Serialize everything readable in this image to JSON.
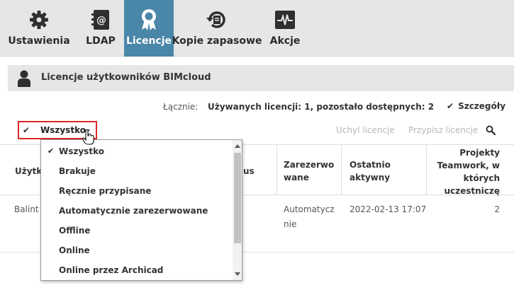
{
  "nav": {
    "tabs": [
      {
        "label": "Ustawienia",
        "icon": "gear-icon"
      },
      {
        "label": "LDAP",
        "icon": "address-book-icon"
      },
      {
        "label": "Licencje",
        "icon": "award-ribbon-icon"
      },
      {
        "label": "Kopie zapasowe",
        "icon": "backup-history-icon"
      },
      {
        "label": "Akcje",
        "icon": "activity-monitor-icon"
      }
    ],
    "active": "Licencje"
  },
  "header": {
    "title": "Licencje użytkowników BIMcloud"
  },
  "summary": {
    "label": "Łącznie:",
    "value": "Używanych licencji: 1, pozostało dostępnych: 2",
    "details": "Szczegóły"
  },
  "filter": {
    "selected": "Wszystko"
  },
  "actions": {
    "revoke": "Uchyl licencje",
    "assign": "Przypisz licencje"
  },
  "table": {
    "headers": [
      "Użytk",
      "us",
      "Zarezerwowane",
      "Ostatnio aktywny",
      "Projekty Teamwork, w których uczestniczę"
    ],
    "header_lines": {
      "reserved": [
        "Zarezerwo",
        "wane"
      ],
      "last_active": [
        "Ostatnio",
        "aktywny"
      ],
      "projects": [
        "Projekty",
        "Teamwork, w",
        "których",
        "uczestniczę"
      ]
    },
    "rows": [
      {
        "user": "Balint",
        "reserved": [
          "Automatycz",
          "nie"
        ],
        "last_active": "2022-02-13 17:07",
        "projects": "2"
      }
    ]
  },
  "dropdown": {
    "options": [
      {
        "label": "Wszystko",
        "checked": true
      },
      {
        "label": "Brakuje",
        "checked": false
      },
      {
        "label": "Ręcznie przypisane",
        "checked": false
      },
      {
        "label": "Automatycznie zarezerwowane",
        "checked": false
      },
      {
        "label": "Offline",
        "checked": false
      },
      {
        "label": "Online",
        "checked": false
      },
      {
        "label": "Online przez Archicad",
        "checked": false
      }
    ]
  },
  "colors": {
    "accent": "#4a86a8",
    "highlight_border": "#e0262b",
    "nav_bg": "#e6e6e6",
    "disabled_text": "#b8b8b8"
  }
}
